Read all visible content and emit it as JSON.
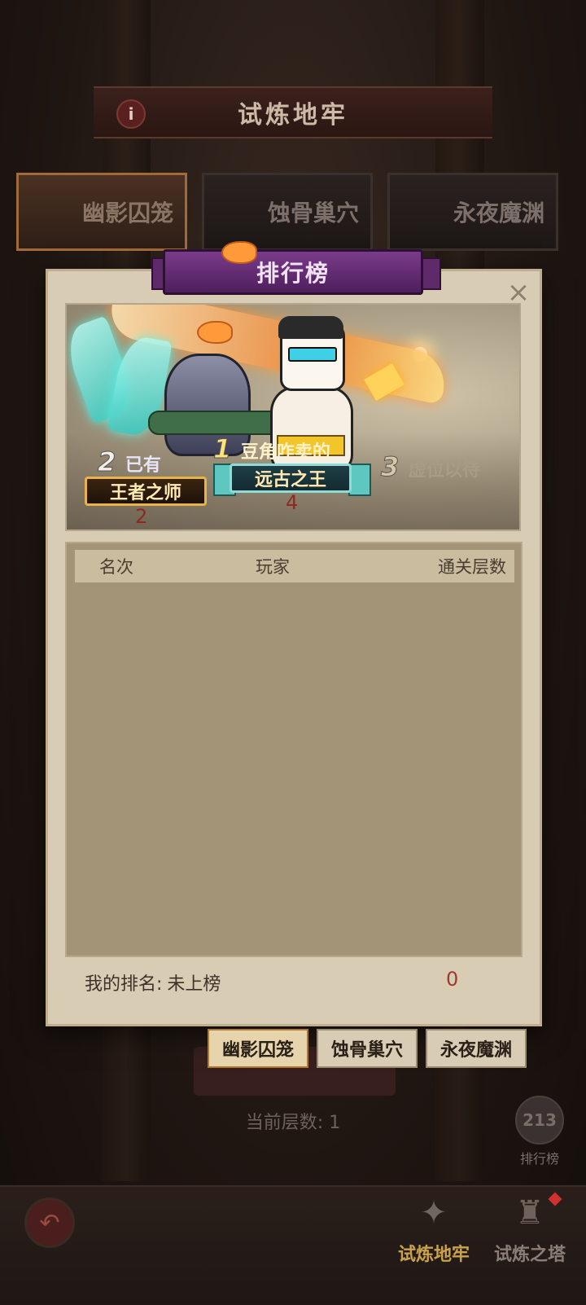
{
  "header": {
    "title": "试炼地牢",
    "info_icon": "info-icon"
  },
  "dungeon_tabs": [
    {
      "label": "幽影囚笼",
      "active": true
    },
    {
      "label": "蚀骨巢穴",
      "active": false
    },
    {
      "label": "永夜魔渊",
      "active": false
    }
  ],
  "modal": {
    "title": "排行榜",
    "close_label": "×",
    "podium": {
      "rank1": {
        "num": "1",
        "name": "豆角咋卖的",
        "title": "远古之王",
        "score": "4"
      },
      "rank2": {
        "num": "2",
        "name": "已有",
        "title": "王者之师",
        "score": "2"
      },
      "rank3": {
        "num": "3",
        "name": "虚位以待"
      }
    },
    "table": {
      "columns": [
        "名次",
        "玩家",
        "通关层数"
      ],
      "rows": []
    },
    "my_rank": {
      "label": "我的排名:",
      "value": "未上榜",
      "score": "0"
    },
    "tabs": [
      {
        "label": "幽影囚笼",
        "active": true
      },
      {
        "label": "蚀骨巢穴",
        "active": false
      },
      {
        "label": "永夜魔渊",
        "active": false
      }
    ]
  },
  "current_floor": {
    "label": "当前层数:",
    "value": "1"
  },
  "rank_shortcut": {
    "label": "排行榜",
    "icon": "ranking-icon"
  },
  "bottom_nav": {
    "back_icon": "back-arrow-icon",
    "items": [
      {
        "label": "试炼地牢",
        "icon": "dungeon-icon",
        "active": true,
        "color": "#c9a24a"
      },
      {
        "label": "试炼之塔",
        "icon": "tower-icon",
        "active": false,
        "color": "#8a7e76",
        "badge": true
      }
    ]
  }
}
